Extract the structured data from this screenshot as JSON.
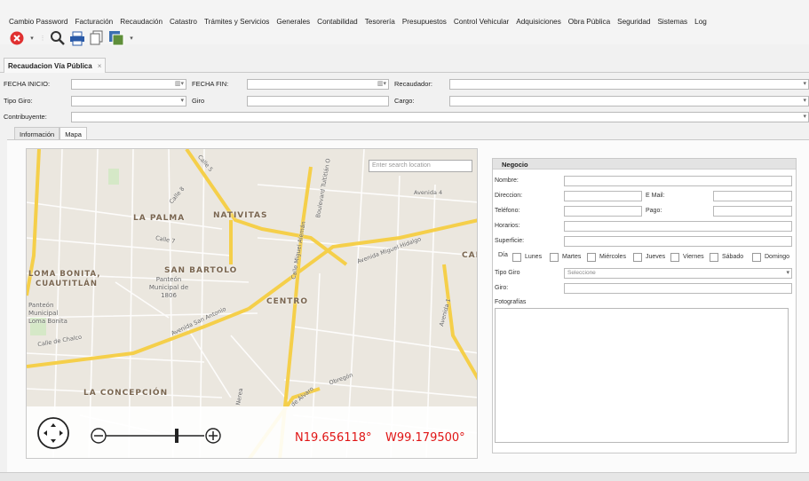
{
  "menu": [
    "Cambio Password",
    "Facturación",
    "Recaudación",
    "Catastro",
    "Trámites y Servicios",
    "Generales",
    "Contabilidad",
    "Tesorería",
    "Presupuestos",
    "Control Vehicular",
    "Adquisiciones",
    "Obra Pública",
    "Seguridad",
    "Sistemas",
    "Log"
  ],
  "toolbar": {
    "icons": [
      "close-icon",
      "search-icon",
      "print-icon",
      "copy-icon",
      "save-icon"
    ],
    "colors": {
      "close": "#e03030",
      "search": "#333333",
      "print": "#2a5aa8"
    }
  },
  "doc_tab": {
    "label": "Recaudacion Vía Pública",
    "close": "×"
  },
  "form": {
    "fecha_inicio_label": "FECHA INICIO:",
    "fecha_fin_label": "FECHA FIN:",
    "recaudador_label": "Recaudador:",
    "tipo_giro_label": "Tipo Giro:",
    "giro_label": "Giro",
    "cargo_label": "Cargo:",
    "contribuyente_label": "Contribuyente:"
  },
  "subtabs": [
    "Información",
    "Mapa"
  ],
  "map": {
    "search_placeholder": "Enter search location",
    "labels": {
      "la_palma": "LA PALMA",
      "nativitas": "NATIVITAS",
      "san_bartolo": "SAN BARTOLO",
      "loma_bonita": "LOMA BONITA,",
      "cuautitlan": "CUAUTITLÁN",
      "centro": "CENTRO",
      "la_concepcion": "LA CONCEPCIÓN",
      "panteon_1806": "Panteón Municipal de 1806",
      "panteon_loma": "Panteón Municipal Loma Bonita",
      "cae": "CAE"
    },
    "streets": {
      "calle5": "Calle 5",
      "calle8": "Calle 8",
      "calle7": "Calle 7",
      "avenida4": "Avenida 4",
      "boulevard": "Boulevard Tultitlán O",
      "miguel_aleman": "Calle Miguel Alemán",
      "miguel_hidalgo": "Avenida Miguel Hidalgo",
      "san_antonio": "Avenida San Antonio",
      "chalco": "Calle de Chalco",
      "avenida1": "Avenida 1",
      "obregon": "Obregón",
      "alvaro": "de Álvaro",
      "nerea": "Nerea"
    },
    "coord_lat": "N19.656118°",
    "coord_lon": "W99.179500°",
    "road_color": "#f5cf4a"
  },
  "negocio": {
    "title": "Negocio",
    "nombre": "Nombre:",
    "direccion": "Direccion:",
    "email": "E Mail:",
    "telefono": "Teléfono:",
    "pago": "Pago:",
    "horarios": "Horarios:",
    "superficie": "Superficie:",
    "dia": "Día",
    "days": [
      "Lunes",
      "Martes",
      "Miércoles",
      "Jueves",
      "Viernes",
      "Sábado",
      "Domingo"
    ],
    "tipo_giro": "Tipo Giro",
    "tipo_giro_value": "Seleccione",
    "giro": "Giro:",
    "fotografias": "Fotografías"
  }
}
